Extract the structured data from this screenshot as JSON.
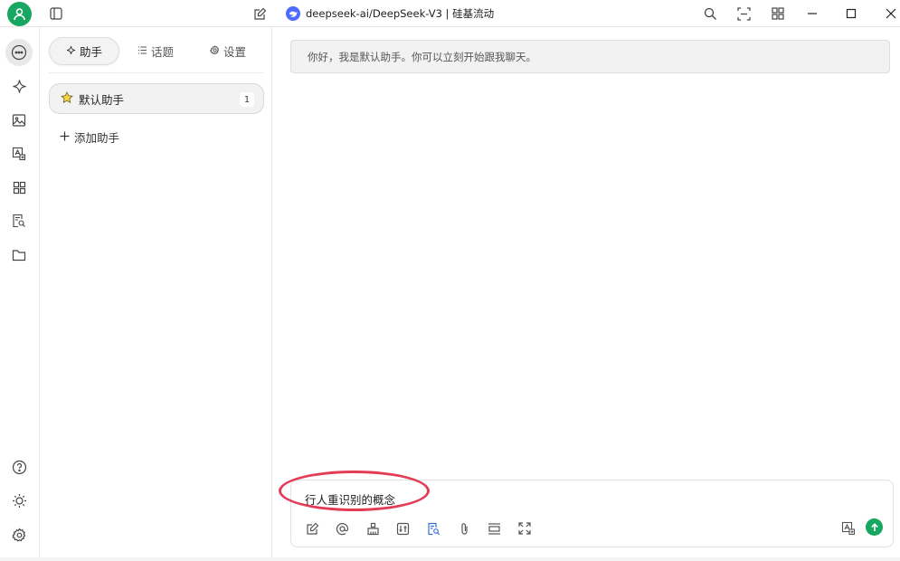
{
  "titlebar": {
    "model_title": "deepseek-ai/DeepSeek-V3 | 硅基流动"
  },
  "panel": {
    "tabs": [
      {
        "label": "助手",
        "icon": "sparkle-icon",
        "active": true
      },
      {
        "label": "话题",
        "icon": "list-icon",
        "active": false
      },
      {
        "label": "设置",
        "icon": "gear-icon",
        "active": false
      }
    ],
    "assistant": {
      "name": "默认助手",
      "count": "1",
      "icon": "star-icon"
    },
    "add_assistant_label": "添加助手"
  },
  "chat": {
    "greeting": "你好，我是默认助手。你可以立刻开始跟我聊天。",
    "input_value": "行人重识别的概念"
  },
  "colors": {
    "accent": "#17a760",
    "highlight": "#e33c55",
    "deepseek_blue": "#4d6bfe"
  }
}
